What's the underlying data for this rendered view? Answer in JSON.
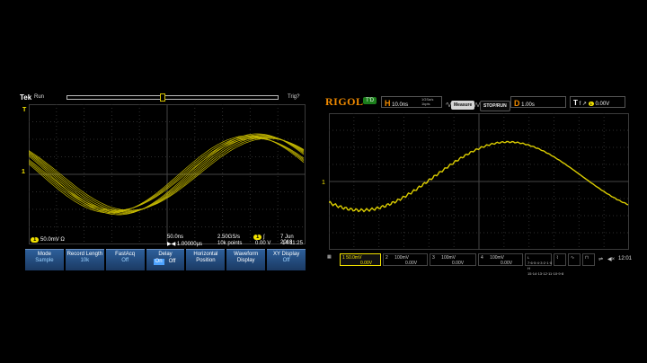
{
  "colors": {
    "trace": "#f2e200",
    "tek_menu": "#1b3a63",
    "rigol_accent": "#f08a00",
    "grid": "#3a3a3a"
  },
  "tek": {
    "brand": "Tek",
    "run_state": "Run",
    "trigger_status": "Trig?",
    "ch1_scale": "50.0mV",
    "ch1_impedance": "Ω",
    "timebase": "50.0ns",
    "sample_rate": "2.50GS/s",
    "position": "1.00000µs",
    "record_points": "10k points",
    "trigger_channel": "1",
    "trigger_level": "0.00 V",
    "date": "7 Jun 2018",
    "time": "14:11:25",
    "ground_marker": "1",
    "trigger_marker": "T",
    "menu": [
      {
        "label": "Mode",
        "value": "Sample"
      },
      {
        "label": "Record Length",
        "value": "10k"
      },
      {
        "label": "FastAcq",
        "value": "Off"
      },
      {
        "label": "Delay",
        "on": "On",
        "off": "Off"
      },
      {
        "label": "Horizontal Position",
        "value": ""
      },
      {
        "label": "Waveform Display",
        "value": ""
      },
      {
        "label": "XY Display",
        "value": "Off"
      }
    ]
  },
  "rigol": {
    "brand": "RIGOL",
    "status": "T'D",
    "horizontal_label": "H",
    "timebase": "10.0ns",
    "sample_rate": "1GSa/s",
    "memory": "1kpts",
    "measure_button": "Measure",
    "stop_run_button": "STOP/RUN",
    "delay_label": "D",
    "delay_value": "1.00s",
    "trigger_label": "T",
    "trigger_level": "0.00V",
    "ch1": {
      "num": "1",
      "scale": "50.0mV",
      "offset": "0.00V"
    },
    "ch2": {
      "num": "2",
      "scale": "100mV",
      "offset": "0.00V"
    },
    "ch3": {
      "num": "3",
      "scale": "100mV",
      "offset": "0.00V"
    },
    "ch4": {
      "num": "4",
      "scale": "100mV",
      "offset": "0.00V"
    },
    "clock": "12:01",
    "ground_marker": "1"
  }
}
